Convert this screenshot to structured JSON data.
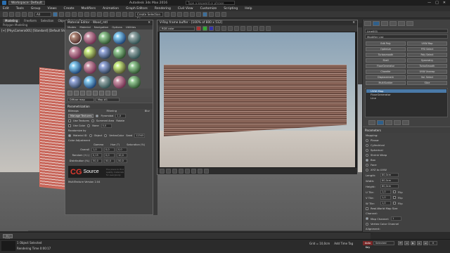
{
  "titlebar": {
    "workspace": "Workspace: Default",
    "title": "Autodesk 3ds Max 2016",
    "search_placeholder": "Type a keyword or phrase",
    "minimize": "—",
    "maximize": "□",
    "close": "✕"
  },
  "menubar": {
    "items": [
      "Edit",
      "Tools",
      "Group",
      "Views",
      "Create",
      "Modifiers",
      "Animation",
      "Graph Editors",
      "Rendering",
      "Civil View",
      "Customize",
      "Scripting",
      "Help"
    ]
  },
  "toolbar": {
    "select_filter": "All",
    "create_selection": "Create Selection Se"
  },
  "ribbon": {
    "tabs": [
      "Modeling",
      "Freeform",
      "Selection",
      "Object Paint",
      "Populate"
    ],
    "active": "Modeling",
    "sub": "Polygon Modeling"
  },
  "viewport": {
    "label": "[+] [PhysCamera001] [Standard] [Default Shading]"
  },
  "material_editor": {
    "title": "Material Editor - Wood_mtl",
    "close": "✕",
    "menu": [
      "Modes",
      "Material",
      "Navigation",
      "Options",
      "Utilities"
    ],
    "material_name": "Diffuse map",
    "map_type": "Map #1",
    "section_title": "Parametrization",
    "bitmaps_label": "Bitmaps",
    "manage_textures": "Manage Textures",
    "filtering_label": "Filtering",
    "blur_label": "Blur",
    "pyramidal": "Pyramidal",
    "summed_area": "Summed Area",
    "none": "None",
    "blur_value": "1,0",
    "rotate_label": "Rotate",
    "rotate_value": "0,0",
    "use_textures": "Use Textures",
    "use_color": "Use Color",
    "randomize_by": "Randomize by",
    "material_id": "Material ID",
    "object": "Object",
    "vertex_id": "VertexColor",
    "seed_label": "Seed",
    "seed_value": "12345",
    "color_adjust": "Color Adjustment",
    "gamma_label": "Gamma",
    "hue_label": "Hue (°)",
    "sat_label": "Saturation (%)",
    "overall": "Overall",
    "overall_vals": [
      "1,0",
      "0,0",
      "0,0"
    ],
    "random": "Random (+/-)",
    "random_vals": [
      "0,15",
      "0,0",
      "10,0"
    ],
    "distribution": "Distribution (%)",
    "dist_vals": [
      "50,0",
      "50,0",
      "50,0"
    ],
    "brand_cg": "CG",
    "brand_source": "Source",
    "brand_small": "The place to find quality materials for everybody",
    "version": "MultiTexture Version 2.04"
  },
  "vfb": {
    "title": "V-Ray frame buffer - [100% of 800 x 512]",
    "close": "✕",
    "channel": "RGB color"
  },
  "cmdpanel": {
    "object_name": "Line001",
    "modifier_list": "Modifier List",
    "modifiers": [
      "Edit Poly",
      "UVW Map",
      "Optimize",
      "FFD Select",
      "Turbosmooth",
      "Poly Select",
      "Shell",
      "Symmetry",
      "FloorGenerator",
      "TurboSmooth",
      "Chamfer",
      "UVW Unwrap",
      "Displacement",
      "Vol. Select",
      "MultiScatter",
      "Slice"
    ],
    "stack": [
      "UVW Map",
      "FloorGenerator",
      "Line"
    ],
    "stack_selected": "UVW Map",
    "params_title": "Parameters",
    "mapping_label": "Mapping:",
    "mapping_opts": [
      "Planar",
      "Cylindrical",
      "Spherical",
      "Shrink Wrap",
      "Box",
      "Face",
      "XYZ to UVW"
    ],
    "mapping_selected": "Box",
    "length_label": "Length:",
    "length_value": "80,0cm",
    "width_label": "Width:",
    "width_value": "80,0cm",
    "height_label": "Height:",
    "height_value": "80,0cm",
    "utile_label": "U Tile:",
    "utile_value": "1,0",
    "vtile_label": "V Tile:",
    "vtile_value": "1,0",
    "wtile_label": "W Tile:",
    "wtile_value": "1,0",
    "flip": "Flip",
    "realworld": "Real-World Map Size",
    "channel_label": "Channel:",
    "map_channel": "Map Channel:",
    "map_channel_value": "1",
    "vertex_channel": "Vertex Color Channel",
    "alignment": "Alignment:"
  },
  "timeline": {
    "frame_range": "0 / 100"
  },
  "status": {
    "line1": "1 Object Selected",
    "line2": "Rendering Time 0:00:17",
    "grid": "Grid = 10,0cm",
    "add_tag": "Add Time Tag",
    "autokey": "Auto Key",
    "selected": "Selected",
    "setkey": "Set Key",
    "keyfilters": "Key Filters...",
    "frame": "0"
  }
}
